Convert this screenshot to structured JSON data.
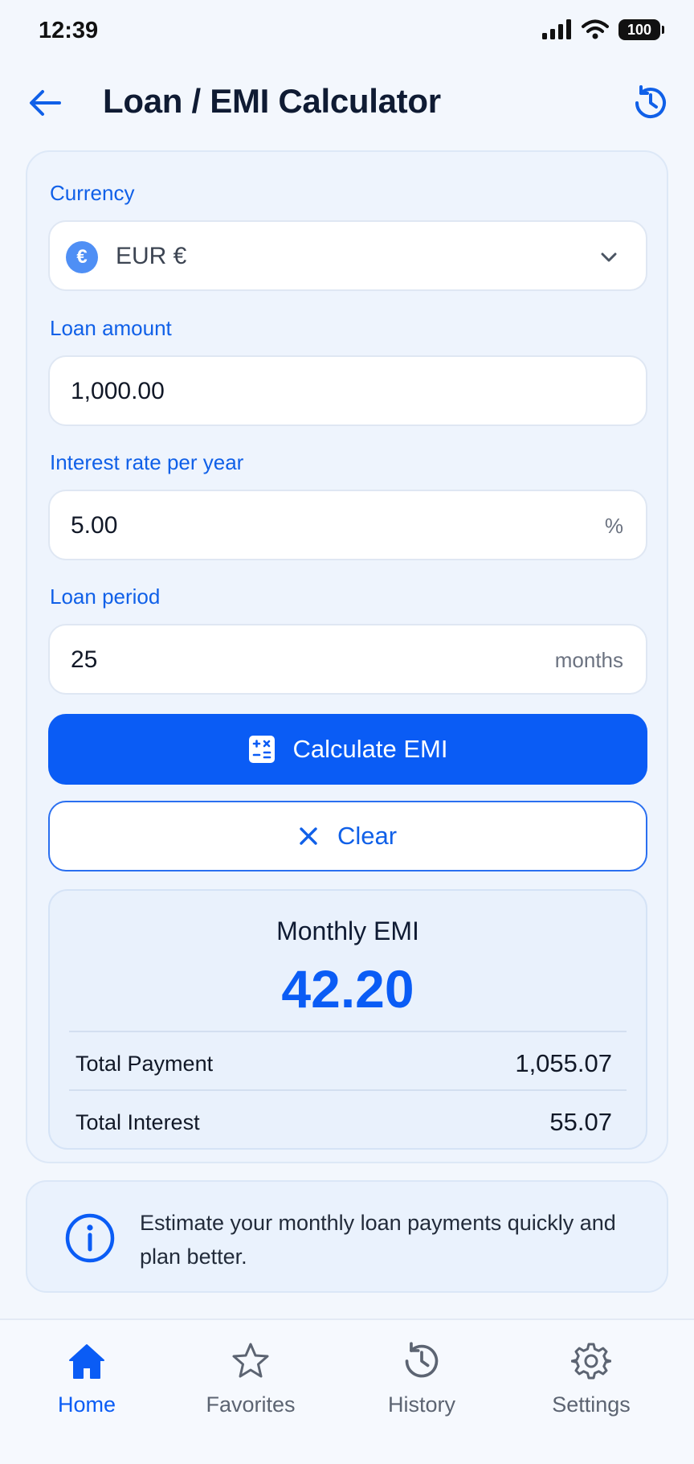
{
  "status_bar": {
    "time": "12:39",
    "battery": "100"
  },
  "header": {
    "title": "Loan / EMI Calculator"
  },
  "currency": {
    "label": "Currency",
    "symbol": "€",
    "value": "EUR  €"
  },
  "loan_amount": {
    "label": "Loan amount",
    "value": "1,000.00"
  },
  "interest_rate": {
    "label": "Interest rate per year",
    "value": "5.00",
    "suffix": "%"
  },
  "loan_period": {
    "label": "Loan period",
    "value": "25",
    "suffix": "months"
  },
  "actions": {
    "calculate_label": "Calculate EMI",
    "clear_label": "Clear"
  },
  "result": {
    "title": "Monthly EMI",
    "emi": "42.20",
    "total_payment_label": "Total Payment",
    "total_payment": "1,055.07",
    "total_interest_label": "Total Interest",
    "total_interest": "55.07"
  },
  "info": {
    "text": "Estimate your monthly loan payments quickly and plan better."
  },
  "nav": {
    "items": [
      {
        "label": "Home",
        "icon": "home-icon",
        "active": true
      },
      {
        "label": "Favorites",
        "icon": "star-icon",
        "active": false
      },
      {
        "label": "History",
        "icon": "history-icon",
        "active": false
      },
      {
        "label": "Settings",
        "icon": "gear-icon",
        "active": false
      }
    ]
  },
  "colors": {
    "accent": "#0a5cf5",
    "label": "#1060e8",
    "background": "#f3f7fd"
  }
}
